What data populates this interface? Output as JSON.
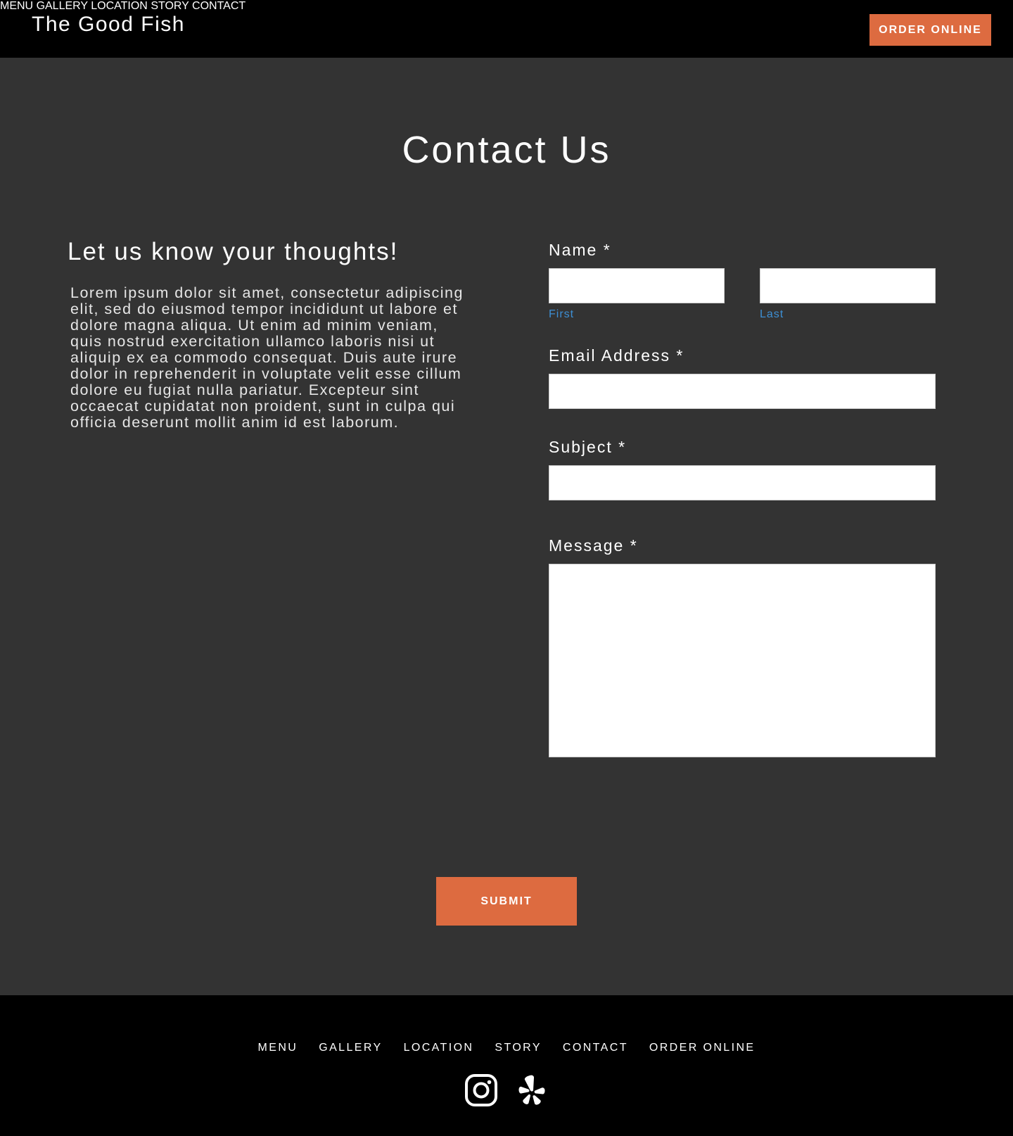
{
  "header": {
    "brand": "The Good Fish",
    "nav": [
      {
        "label": "MENU"
      },
      {
        "label": "GALLERY"
      },
      {
        "label": "LOCATION"
      },
      {
        "label": "STORY"
      },
      {
        "label": "CONTACT"
      }
    ],
    "order_label": "ORDER ONLINE"
  },
  "main": {
    "title": "Contact Us",
    "intro_heading": "Let us know your thoughts!",
    "intro_body": "Lorem ipsum dolor sit amet, consectetur adipiscing elit, sed do eiusmod tempor incididunt ut labore et dolore magna aliqua. Ut enim ad minim veniam, quis nostrud exercitation ullamco laboris nisi ut aliquip ex ea commodo consequat. Duis aute irure dolor in reprehenderit in voluptate velit esse cillum dolore eu fugiat nulla pariatur. Excepteur sint occaecat cupidatat non proident, sunt in culpa qui officia deserunt mollit anim id est laborum."
  },
  "form": {
    "name_label": "Name *",
    "first_label": "First",
    "last_label": "Last",
    "first_value": "",
    "last_value": "",
    "email_label": "Email Address *",
    "email_value": "",
    "subject_label": "Subject *",
    "subject_value": "",
    "message_label": "Message *",
    "message_value": "",
    "submit_label": "SUBMIT"
  },
  "footer": {
    "nav": [
      {
        "label": "MENU"
      },
      {
        "label": "GALLERY"
      },
      {
        "label": "LOCATION"
      },
      {
        "label": "STORY"
      },
      {
        "label": "CONTACT"
      },
      {
        "label": "ORDER ONLINE"
      }
    ],
    "social_icons": [
      "instagram-icon",
      "yelp-icon"
    ]
  },
  "colors": {
    "accent": "#dd6b40",
    "background": "#333333",
    "header_footer": "#000000",
    "sublabel": "#3d8fd4"
  }
}
